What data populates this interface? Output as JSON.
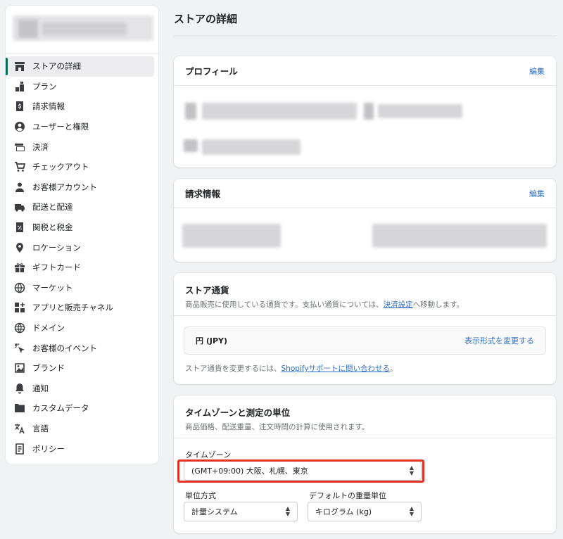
{
  "page": {
    "title": "ストアの詳細"
  },
  "sidebar": {
    "items": [
      {
        "label": "ストアの詳細",
        "icon": "store-icon",
        "active": true
      },
      {
        "label": "プラン",
        "icon": "plan-icon"
      },
      {
        "label": "請求情報",
        "icon": "billing-icon"
      },
      {
        "label": "ユーザーと権限",
        "icon": "user-circle-icon"
      },
      {
        "label": "決済",
        "icon": "payment-icon"
      },
      {
        "label": "チェックアウト",
        "icon": "cart-icon"
      },
      {
        "label": "お客様アカウント",
        "icon": "person-icon"
      },
      {
        "label": "配送と配達",
        "icon": "truck-icon"
      },
      {
        "label": "関税と税金",
        "icon": "tax-icon"
      },
      {
        "label": "ロケーション",
        "icon": "location-icon"
      },
      {
        "label": "ギフトカード",
        "icon": "gift-icon"
      },
      {
        "label": "マーケット",
        "icon": "globe-icon"
      },
      {
        "label": "アプリと販売チャネル",
        "icon": "apps-icon"
      },
      {
        "label": "ドメイン",
        "icon": "domain-icon"
      },
      {
        "label": "お客様のイベント",
        "icon": "events-icon"
      },
      {
        "label": "ブランド",
        "icon": "brand-icon"
      },
      {
        "label": "通知",
        "icon": "bell-icon"
      },
      {
        "label": "カスタムデータ",
        "icon": "custom-data-icon"
      },
      {
        "label": "言語",
        "icon": "language-icon"
      },
      {
        "label": "ポリシー",
        "icon": "policy-icon"
      }
    ]
  },
  "profile": {
    "title": "プロフィール",
    "edit": "編集"
  },
  "billing": {
    "title": "請求情報",
    "edit": "編集"
  },
  "currency": {
    "title": "ストア通貨",
    "desc_prefix": "商品販売に使用している通貨です。支払い通貨については、",
    "desc_link": "決済設定",
    "desc_suffix": "へ移動します。",
    "value": "円 (JPY)",
    "change_format": "表示形式を変更する",
    "footer_prefix": "ストア通貨を変更するには、",
    "footer_link": "Shopifyサポートに問い合わせる",
    "footer_suffix": "。"
  },
  "timezone": {
    "title": "タイムゾーンと測定の単位",
    "desc": "商品価格、配送重量、注文時間の計算に使用されます。",
    "tz_label": "タイムゾーン",
    "tz_value": "(GMT+09:00) 大阪、札幌、東京",
    "unit_label": "単位方式",
    "unit_value": "計量システム",
    "weight_label": "デフォルトの重量単位",
    "weight_value": "キログラム (kg)"
  },
  "colors": {
    "accent": "#006e52",
    "link": "#2c6ecb",
    "highlight": "#e63222"
  }
}
